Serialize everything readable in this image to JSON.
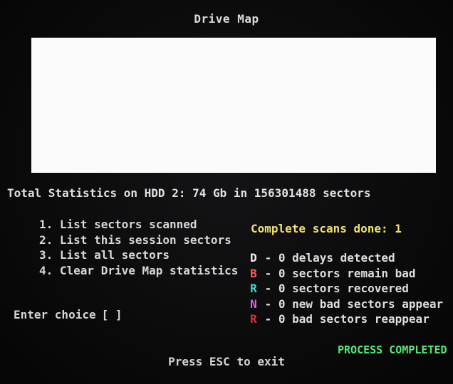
{
  "title": "Drive Map",
  "totals": "Total Statistics on HDD 2: 74 Gb in 156301488 sectors",
  "menu": [
    {
      "label": "1. List sectors scanned"
    },
    {
      "label": "2. List this session sectors"
    },
    {
      "label": "3. List all sectors"
    },
    {
      "label": "4. Clear Drive Map statistics"
    }
  ],
  "choice": {
    "label": "Enter choice",
    "value": "[ ]"
  },
  "scans": "Complete scans done: 1",
  "legend": [
    {
      "key": "D",
      "color": "#f2f2f2",
      "text": " - 0 delays detected"
    },
    {
      "key": "B",
      "color": "#ff5a5a",
      "text": " - 0 sectors remain bad"
    },
    {
      "key": "R",
      "color": "#40d8d0",
      "text": " - 0 sectors recovered"
    },
    {
      "key": "N",
      "color": "#e060f0",
      "text": " - 0 new bad sectors appear"
    },
    {
      "key": "R",
      "color": "#d83030",
      "text": " - 0 bad sectors reappear"
    }
  ],
  "status": "PROCESS COMPLETED",
  "exit_hint": "Press ESC to exit"
}
